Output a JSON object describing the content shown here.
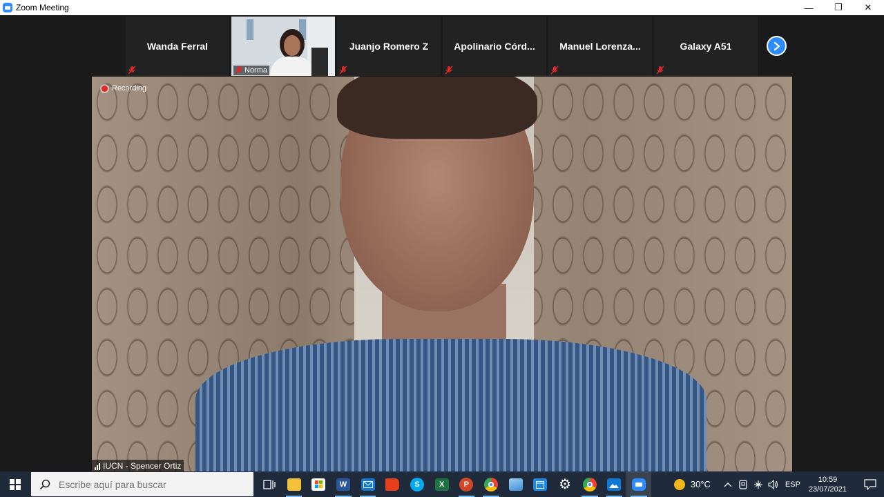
{
  "window": {
    "title": "Zoom Meeting",
    "controls": {
      "minimize": "—",
      "maximize": "❐",
      "close": "✕"
    }
  },
  "participants": [
    {
      "name": "Wanda Ferral",
      "video": false,
      "muted": true
    },
    {
      "name": "Norma",
      "video": true,
      "muted": true
    },
    {
      "name": "Juanjo Romero Z",
      "video": false,
      "muted": true
    },
    {
      "name": "Apolinario  Córd...",
      "video": false,
      "muted": true
    },
    {
      "name": "Manuel  Lorenza...",
      "video": false,
      "muted": true
    },
    {
      "name": "Galaxy A51",
      "video": false,
      "muted": true
    }
  ],
  "speaker": {
    "recording_label": "Recording",
    "name": "IUCN - Spencer Ortiz"
  },
  "taskbar": {
    "search_placeholder": "Escribe aquí para buscar",
    "apps": [
      {
        "name": "task-view-icon",
        "label": "",
        "color": "#1f2b3a"
      },
      {
        "name": "file-explorer-icon",
        "label": "",
        "color": "#f3c13a"
      },
      {
        "name": "microsoft-store-icon",
        "label": "",
        "color": "#ffffff"
      },
      {
        "name": "word-icon",
        "label": "W",
        "color": "#2b579a"
      },
      {
        "name": "mail-icon",
        "label": "",
        "color": "#0f78d4"
      },
      {
        "name": "office-icon",
        "label": "",
        "color": "#e3401b"
      },
      {
        "name": "skype-icon",
        "label": "S",
        "color": "#00a9f0"
      },
      {
        "name": "excel-icon",
        "label": "X",
        "color": "#1f7244"
      },
      {
        "name": "powerpoint-icon",
        "label": "P",
        "color": "#d24726"
      },
      {
        "name": "chrome-icon",
        "label": "",
        "color": "#34a853"
      },
      {
        "name": "cloud-drive-icon",
        "label": "",
        "color": "#3d8fd6"
      },
      {
        "name": "calendar-icon",
        "label": "",
        "color": "#1e88e5"
      },
      {
        "name": "settings-icon",
        "label": "⚙",
        "color": "#1f2b3a"
      },
      {
        "name": "chrome-profile-icon",
        "label": "",
        "color": "#ea4335"
      },
      {
        "name": "photos-icon",
        "label": "",
        "color": "#0f78d4"
      },
      {
        "name": "zoom-icon",
        "label": "",
        "color": "#2d8cff"
      }
    ],
    "weather": "30°C",
    "language": "ESP",
    "time": "10:59",
    "date": "23/07/2021"
  },
  "colors": {
    "accent": "#2d8cff",
    "mute": "#e02828",
    "tile_bg": "#222222"
  }
}
